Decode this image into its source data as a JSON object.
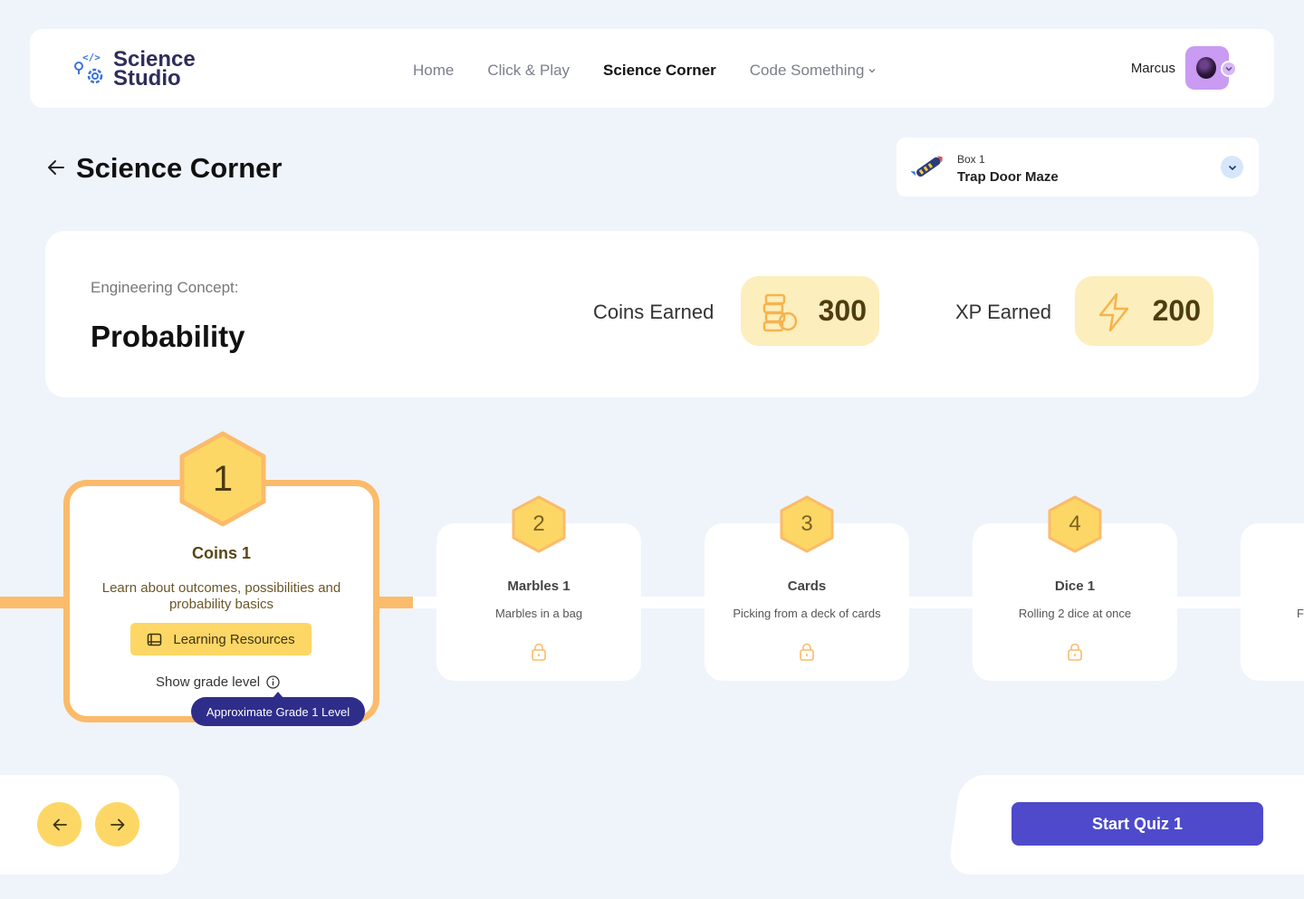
{
  "header": {
    "logo_line1": "Science",
    "logo_line2": "Studio",
    "nav": [
      "Home",
      "Click & Play",
      "Science Corner",
      "Code Something"
    ],
    "user_name": "Marcus"
  },
  "page": {
    "title": "Science Corner"
  },
  "box_select": {
    "label": "Box 1",
    "name": "Trap Door Maze",
    "icon": "rocket-icon"
  },
  "concept": {
    "label": "Engineering Concept:",
    "name": "Probability",
    "coins_label": "Coins Earned",
    "coins_value": "300",
    "xp_label": "XP Earned",
    "xp_value": "200"
  },
  "levels": {
    "active": {
      "number": "1",
      "title": "Coins 1",
      "description": "Learn about outcomes, possibilities and probability basics",
      "resources_label": "Learning Resources",
      "grade_link": "Show grade level",
      "tooltip": "Approximate Grade 1 Level"
    },
    "items": [
      {
        "number": "2",
        "title": "Marbles 1",
        "description": "Marbles in a bag"
      },
      {
        "number": "3",
        "title": "Cards",
        "description": "Picking from a deck of cards"
      },
      {
        "number": "4",
        "title": "Dice 1",
        "description": "Rolling 2 dice at once"
      }
    ],
    "partial_card_text": "Fa"
  },
  "actions": {
    "start_quiz": "Start Quiz 1"
  },
  "colors": {
    "accent": "#4e4acb",
    "active_border": "#fbbb6a",
    "hex_fill": "#fdd766",
    "tooltip_bg": "#2f2d8a"
  }
}
